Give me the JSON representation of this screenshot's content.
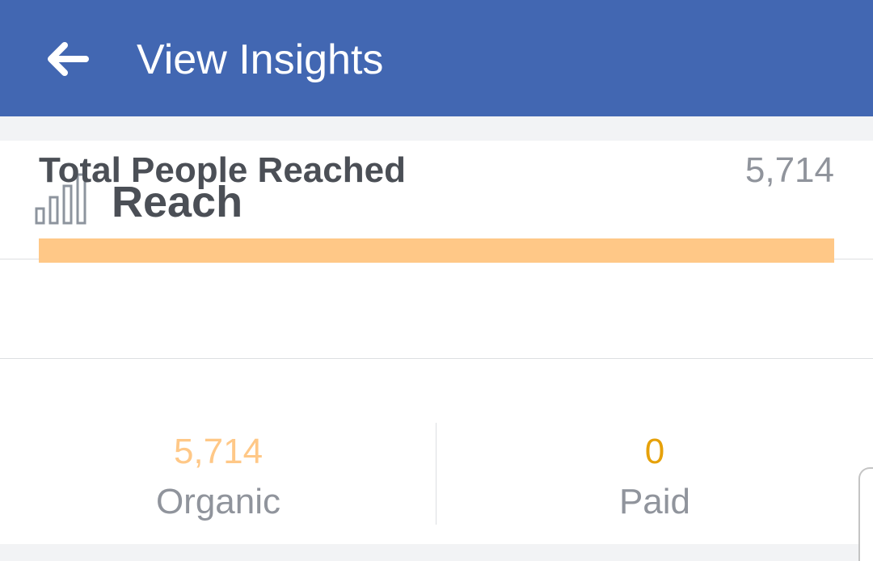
{
  "header": {
    "back_icon": "back-arrow-icon",
    "title": "View Insights",
    "bg_color": "#4267b2"
  },
  "reach": {
    "icon": "bar-chart-icon",
    "title": "Reach"
  },
  "total": {
    "label": "Total People Reached",
    "value": "5,714"
  },
  "breakdown": {
    "organic_fraction": 1.0,
    "organic": {
      "value": "5,714",
      "label": "Organic",
      "color": "#ffc887"
    },
    "paid": {
      "value": "0",
      "label": "Paid",
      "color": "#e6a10a"
    }
  }
}
